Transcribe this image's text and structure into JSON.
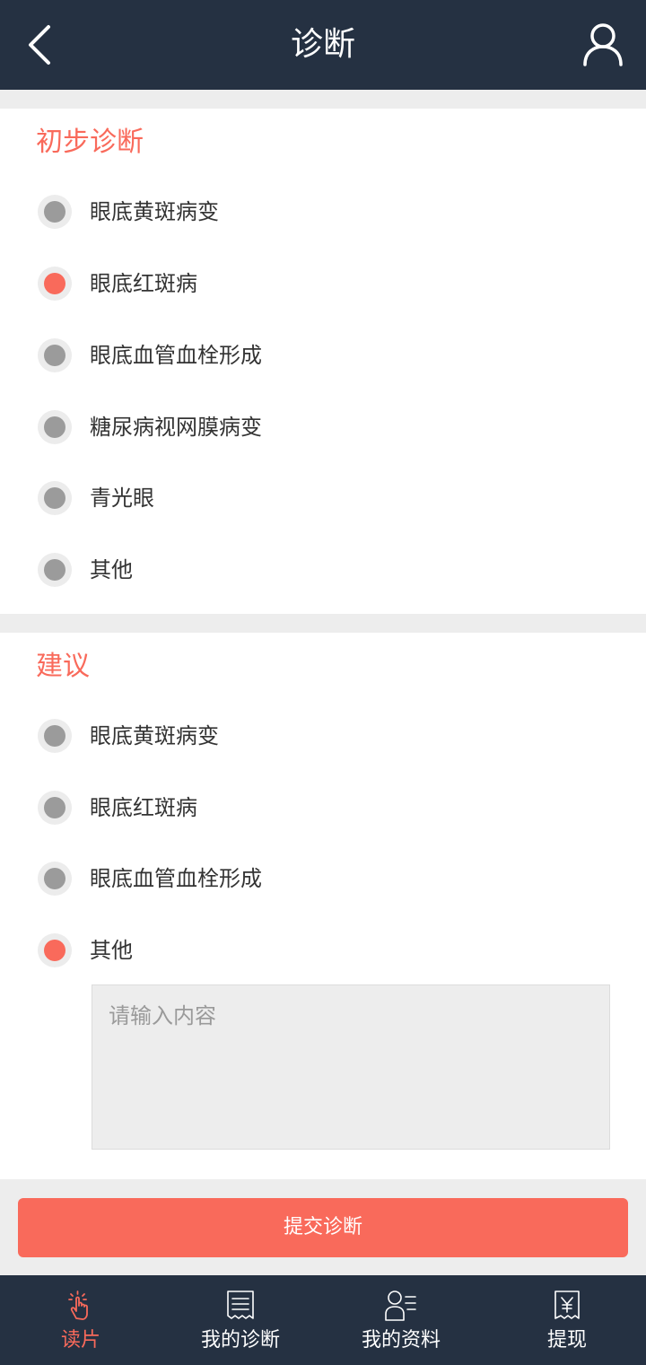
{
  "header": {
    "title": "诊断",
    "back_icon": "chevron-left-icon",
    "user_icon": "user-icon"
  },
  "diagnosis": {
    "title": "初步诊断",
    "options": [
      {
        "label": "眼底黄斑病变",
        "checked": false
      },
      {
        "label": "眼底红斑病",
        "checked": true
      },
      {
        "label": "眼底血管血栓形成",
        "checked": false
      },
      {
        "label": "糖尿病视网膜病变",
        "checked": false
      },
      {
        "label": "青光眼",
        "checked": false
      },
      {
        "label": "其他",
        "checked": false
      }
    ]
  },
  "suggestion": {
    "title": "建议",
    "options": [
      {
        "label": "眼底黄斑病变",
        "checked": false
      },
      {
        "label": "眼底红斑病",
        "checked": false
      },
      {
        "label": "眼底血管血栓形成",
        "checked": false
      },
      {
        "label": "其他",
        "checked": true
      }
    ],
    "input_placeholder": "请输入内容",
    "input_value": ""
  },
  "submit_label": "提交诊断",
  "tabs": [
    {
      "label": "读片",
      "icon": "hand-tap-icon",
      "active": true
    },
    {
      "label": "我的诊断",
      "icon": "document-list-icon",
      "active": false
    },
    {
      "label": "我的资料",
      "icon": "profile-icon",
      "active": false
    },
    {
      "label": "提现",
      "icon": "yuan-receipt-icon",
      "active": false
    }
  ],
  "colors": {
    "accent": "#f96a5b",
    "header_bg": "#253142",
    "radio_off": "#9b9b9b"
  }
}
